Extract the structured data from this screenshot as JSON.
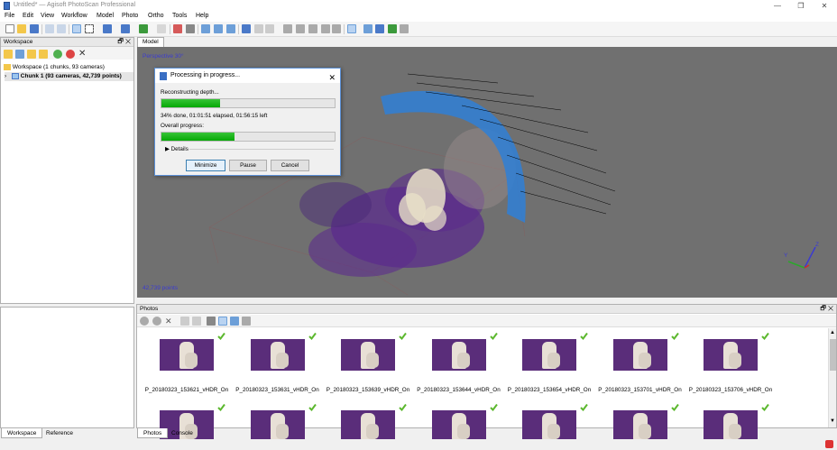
{
  "window": {
    "title": "Untitled* — Agisoft PhotoScan Professional",
    "controls": [
      "—",
      "❐",
      "✕"
    ]
  },
  "menu": [
    "File",
    "Edit",
    "View",
    "Workflow",
    "Model",
    "Photo",
    "Ortho",
    "Tools",
    "Help"
  ],
  "workspace": {
    "panel_title": "Workspace",
    "root_label": "Workspace (1 chunks, 93 cameras)",
    "chunk_label": "Chunk 1 (93 cameras, 42,739 points)"
  },
  "bottom_left_tabs": [
    "Workspace",
    "Reference"
  ],
  "model": {
    "tab_label": "Model",
    "view_label": "Perspective 30°",
    "points_label": "42,739 points",
    "axis_y": "Y",
    "axis_z": "Z"
  },
  "dialog": {
    "title": "Processing in progress...",
    "task_label": "Reconstructing depth...",
    "task_progress": 34,
    "status_text": "34% done, 01:01:51 elapsed, 01:56:15 left",
    "overall_label": "Overall progress:",
    "overall_progress": 42,
    "details_label": "Details",
    "buttons": {
      "minimize": "Minimize",
      "pause": "Pause",
      "cancel": "Cancel"
    }
  },
  "photos": {
    "panel_title": "Photos",
    "items": [
      "P_20180323_153621_vHDR_On",
      "P_20180323_153631_vHDR_On",
      "P_20180323_153639_vHDR_On",
      "P_20180323_153644_vHDR_On",
      "P_20180323_153654_vHDR_On",
      "P_20180323_153701_vHDR_On",
      "P_20180323_153706_vHDR_On"
    ]
  },
  "bottom_center_tabs": [
    "Photos",
    "Console"
  ],
  "colors": {
    "accent_green": "#06a806",
    "check_green": "#5cb82e",
    "viewport_bg": "#707070",
    "point_purple": "#5b2c8c",
    "camera_blue": "#2f7fd6"
  }
}
